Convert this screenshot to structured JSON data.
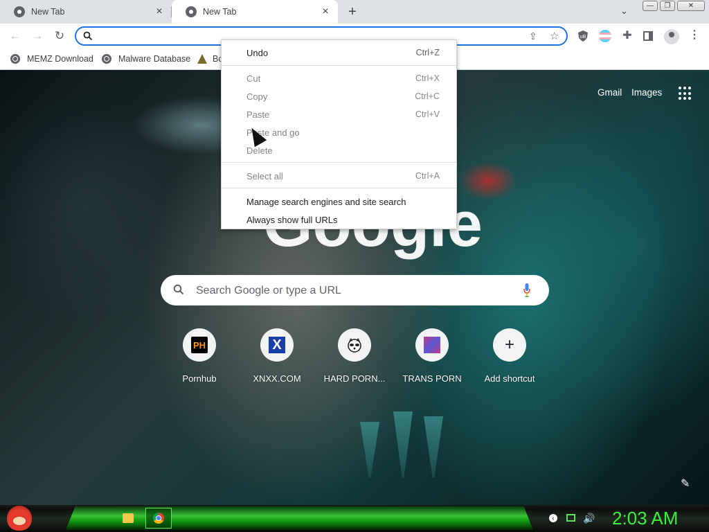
{
  "tabs": [
    {
      "title": "New Tab",
      "active": false
    },
    {
      "title": "New Tab",
      "active": true
    }
  ],
  "toolbar": {
    "omnibox_value": ""
  },
  "bookmarks": [
    {
      "label": "MEMZ Download"
    },
    {
      "label": "Malware Database"
    },
    {
      "label": "Bo"
    }
  ],
  "header_links": {
    "gmail": "Gmail",
    "images": "Images"
  },
  "logo_text": "Google",
  "search": {
    "placeholder": "Search Google or type a URL"
  },
  "shortcuts": [
    {
      "label": "Pornhub",
      "badge": "PH"
    },
    {
      "label": "XNXX.COM",
      "badge": "X"
    },
    {
      "label": "HARD PORN...",
      "badge": "raccoon"
    },
    {
      "label": "TRANS PORN",
      "badge": "thumbnail"
    },
    {
      "label": "Add shortcut",
      "badge": "+"
    }
  ],
  "context_menu": [
    {
      "label": "Undo",
      "shortcut": "Ctrl+Z",
      "disabled": false
    },
    {
      "label": "Cut",
      "shortcut": "Ctrl+X",
      "disabled": true
    },
    {
      "label": "Copy",
      "shortcut": "Ctrl+C",
      "disabled": true
    },
    {
      "label": "Paste",
      "shortcut": "Ctrl+V",
      "disabled": true
    },
    {
      "label": "Paste and go",
      "shortcut": "",
      "disabled": true
    },
    {
      "label": "Delete",
      "shortcut": "",
      "disabled": true
    },
    {
      "label": "Select all",
      "shortcut": "Ctrl+A",
      "disabled": true
    },
    {
      "label": "Manage search engines and site search",
      "shortcut": "",
      "disabled": false
    },
    {
      "label": "Always show full URLs",
      "shortcut": "",
      "disabled": false
    }
  ],
  "taskbar": {
    "clock": "2:03 AM"
  },
  "colors": {
    "accent": "#1a73e8",
    "clock": "#3df03d",
    "taskbar_green": "#38c238"
  }
}
